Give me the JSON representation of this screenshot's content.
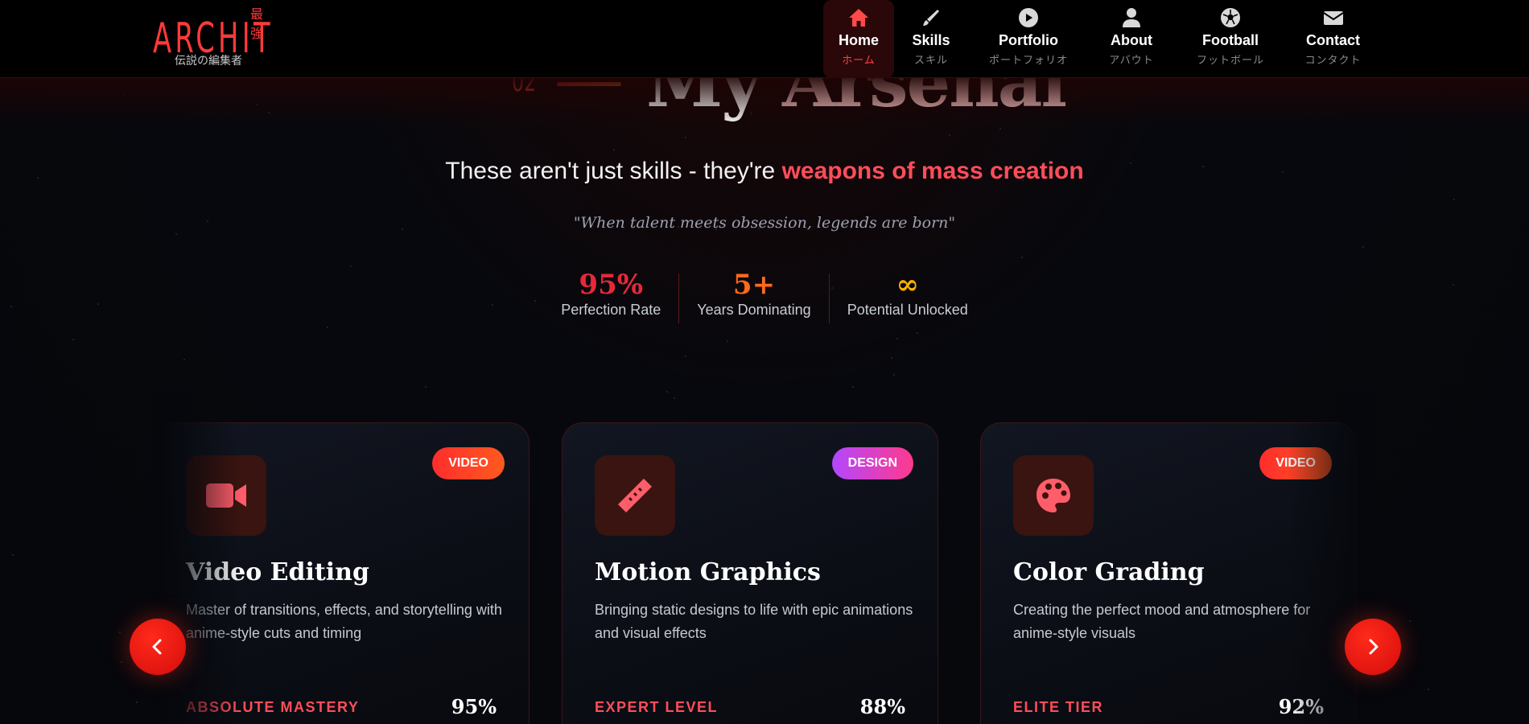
{
  "logo": {
    "main": "ARCHIT",
    "sup": "最強",
    "sub": "伝説の編集者"
  },
  "nav": {
    "items": [
      {
        "label": "Home",
        "jp": "ホーム",
        "icon": "home-icon",
        "active": true
      },
      {
        "label": "Skills",
        "jp": "スキル",
        "icon": "brush-icon",
        "active": false
      },
      {
        "label": "Portfolio",
        "jp": "ポートフォリオ",
        "icon": "play-circle-icon",
        "active": false
      },
      {
        "label": "About",
        "jp": "アバウト",
        "icon": "user-icon",
        "active": false
      },
      {
        "label": "Football",
        "jp": "フットボール",
        "icon": "football-icon",
        "active": false
      },
      {
        "label": "Contact",
        "jp": "コンタクト",
        "icon": "envelope-icon",
        "active": false
      }
    ]
  },
  "section": {
    "number": "02",
    "title_part1": "My ",
    "title_part2": "Arsenal",
    "subtitle_plain": "These aren't just skills - they're ",
    "subtitle_highlight": "weapons of mass creation",
    "quote": "\"When talent meets obsession, legends are born\""
  },
  "stats": [
    {
      "value": "95%",
      "label": "Perfection Rate",
      "color": "#e8283a"
    },
    {
      "value": "5+",
      "label": "Years Dominating",
      "color": "#ff6a1a"
    },
    {
      "value": "∞",
      "label": "Potential Unlocked",
      "color": "#f5b000"
    }
  ],
  "cards": [
    {
      "title": "Video Editing",
      "desc": "Master of transitions, effects, and storytelling with anime-style cuts and timing",
      "badge": "VIDEO",
      "level": "ABSOLUTE MASTERY",
      "percent": "95%",
      "progress": 0.95,
      "icon": "video-camera-icon",
      "badge_gradient": [
        "#ff2d2d",
        "#ff5a1f"
      ],
      "bar_gradient": [
        "#ff2d3a",
        "#ff7a10"
      ]
    },
    {
      "title": "Motion Graphics",
      "desc": "Bringing static designs to life with epic animations and visual effects",
      "badge": "DESIGN",
      "level": "EXPERT LEVEL",
      "percent": "88%",
      "progress": 0.88,
      "icon": "ruler-pen-icon",
      "badge_gradient": [
        "#b347ff",
        "#ff3a8c"
      ],
      "bar_gradient": [
        "#b347ff",
        "#ff2f86"
      ]
    },
    {
      "title": "Color Grading",
      "desc": "Creating the perfect mood and atmosphere for anime-style visuals",
      "badge": "VIDEO",
      "level": "ELITE TIER",
      "percent": "92%",
      "progress": 0.92,
      "icon": "palette-icon",
      "badge_gradient": [
        "#ff2d2d",
        "#ff5a1f"
      ],
      "bar_gradient": [
        "#ff2d3a",
        "#ff7a10"
      ]
    }
  ],
  "carousel": {
    "prev_icon": "chevron-left-icon",
    "next_icon": "chevron-right-icon"
  }
}
